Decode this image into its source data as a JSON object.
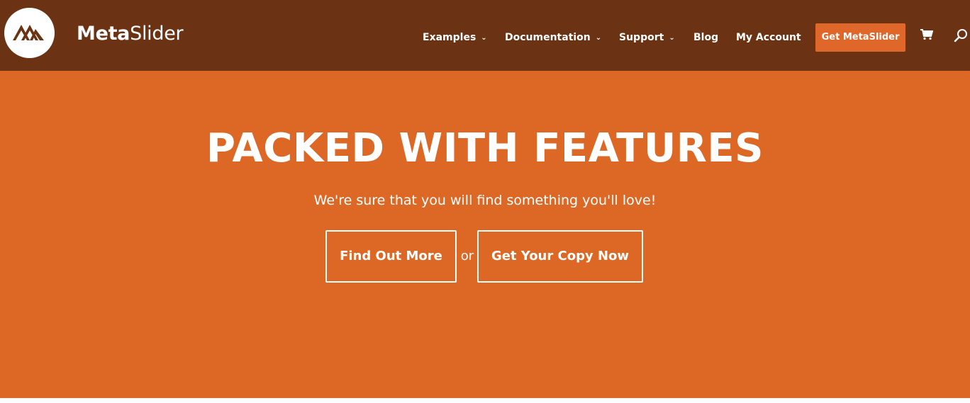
{
  "header": {
    "brand_bold": "Meta",
    "brand_light": "Slider",
    "nav": [
      {
        "label": "Examples",
        "has_dropdown": true
      },
      {
        "label": "Documentation",
        "has_dropdown": true
      },
      {
        "label": "Support",
        "has_dropdown": true
      },
      {
        "label": "Blog",
        "has_dropdown": false
      },
      {
        "label": "My Account",
        "has_dropdown": false
      }
    ],
    "cta_label": "Get MetaSlider",
    "icons": {
      "logo": "metaslider-logo-icon",
      "cart": "cart-icon",
      "search": "search-icon",
      "chevron": "chevron-down-icon"
    }
  },
  "hero": {
    "title": "PACKED WITH FEATURES",
    "subtitle": "We're sure that you will find something you'll love!",
    "primary_button": "Find Out More",
    "separator": "or",
    "secondary_button": "Get Your Copy Now"
  },
  "colors": {
    "header_bg": "#6b3214",
    "hero_bg": "#dd6826",
    "cta_bg": "#e0672a",
    "text": "#ffffff"
  }
}
